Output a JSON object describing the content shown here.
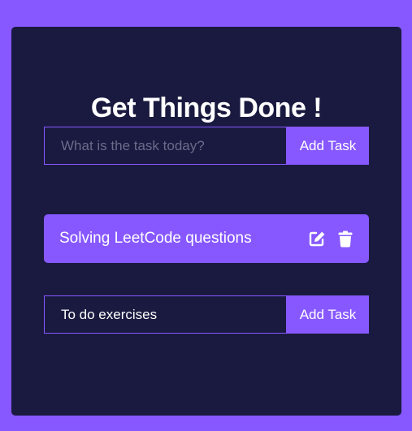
{
  "app": {
    "title": "Get Things Done !"
  },
  "new_task_form": {
    "placeholder": "What is the task today?",
    "value": "",
    "submit_label": "Add Task"
  },
  "todos": [
    {
      "text": "Solving LeetCode questions",
      "actions": [
        "edit-icon",
        "trash-icon"
      ]
    }
  ],
  "edit_form": {
    "value": "To do exercises",
    "submit_label": "Add Task"
  },
  "colors": {
    "background": "#8758ff",
    "panel": "#1a1a40",
    "accent": "#8758ff",
    "text": "#ffffff",
    "placeholder": "#6b6b8a"
  }
}
